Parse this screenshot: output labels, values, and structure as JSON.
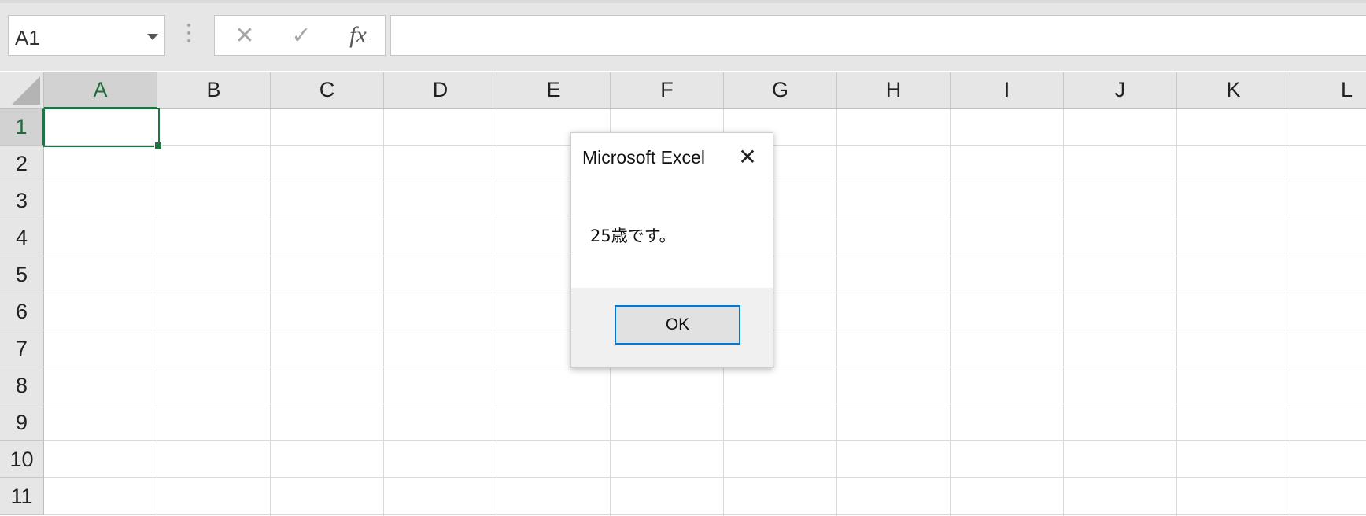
{
  "formula_bar": {
    "name_box_value": "A1",
    "formula_value": "",
    "icons": [
      "cancel-icon",
      "enter-icon",
      "function-icon"
    ],
    "cancel_glyph": "✕",
    "enter_glyph": "✓",
    "function_glyph": "fx"
  },
  "sheet": {
    "columns": [
      "A",
      "B",
      "C",
      "D",
      "E",
      "F",
      "G",
      "H",
      "I",
      "J",
      "K",
      "L"
    ],
    "rows": [
      "1",
      "2",
      "3",
      "4",
      "5",
      "6",
      "7",
      "8",
      "9",
      "10",
      "11"
    ],
    "selected_cell": "A1",
    "accent_color": "#217346"
  },
  "dialog": {
    "title": "Microsoft Excel",
    "close_glyph": "✕",
    "message": "25歳です。",
    "ok_label": "OK",
    "ok_border_color": "#0078d7"
  }
}
